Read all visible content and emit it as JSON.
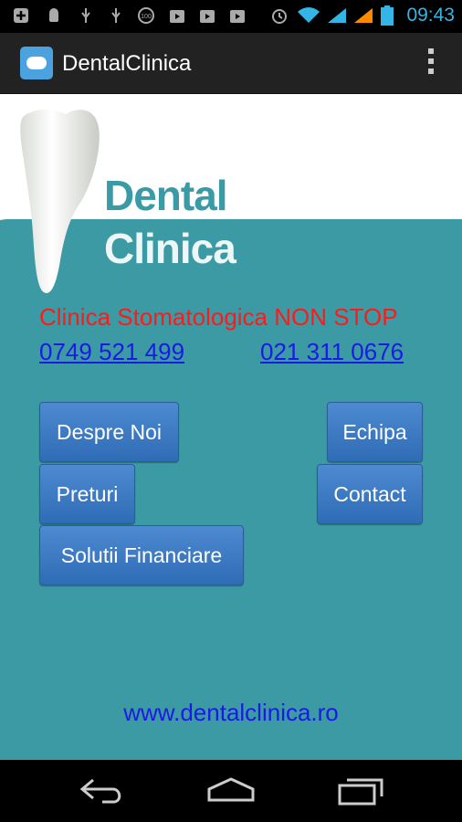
{
  "status_bar": {
    "time": "09:43",
    "icons": [
      "add-icon",
      "android-debug-icon",
      "usb-icon",
      "usb-icon",
      "battery-100-icon",
      "play-icon",
      "play-icon",
      "play-icon",
      "alarm-icon",
      "wifi-icon",
      "signal-icon",
      "signal-icon",
      "battery-icon"
    ]
  },
  "action_bar": {
    "title": "DentalClinica"
  },
  "header": {
    "brand_line1": "Dental",
    "brand_line2": "Clinica"
  },
  "main": {
    "slogan": "Clinica Stomatologica NON STOP",
    "phone1": "0749 521 499",
    "phone2": "021 311 0676",
    "buttons": {
      "despre_noi": "Despre Noi",
      "echipa": "Echipa",
      "preturi": "Preturi",
      "contact": "Contact",
      "solutii": "Solutii Financiare"
    },
    "website": "www.dentalclinica.ro"
  },
  "colors": {
    "teal_background": "#3b9aa4",
    "button_blue": "#3a78c2",
    "slogan_red": "#ff1a1a",
    "link_blue": "#1a1ae6",
    "status_blue": "#33b5e5"
  }
}
